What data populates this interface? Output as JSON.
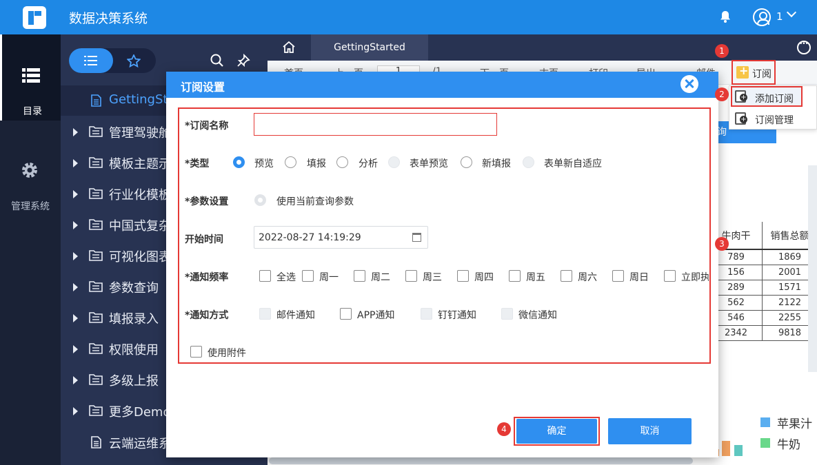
{
  "app": {
    "title": "数据决策系统",
    "user": "1"
  },
  "leftnav": {
    "directory_label": "目录",
    "admin_label": "管理系统"
  },
  "tree": {
    "items": [
      {
        "label": "GettingStarted"
      },
      {
        "label": "管理驾驶舱"
      },
      {
        "label": "模板主题示例"
      },
      {
        "label": "行业化模板"
      },
      {
        "label": "中国式复杂报表"
      },
      {
        "label": "可视化图表"
      },
      {
        "label": "参数查询"
      },
      {
        "label": "填报录入"
      },
      {
        "label": "权限使用"
      },
      {
        "label": "多级上报"
      },
      {
        "label": "更多Demo"
      },
      {
        "label": "云端运维系统"
      }
    ]
  },
  "tabs": {
    "active": "GettingStarted"
  },
  "toolbar": {
    "first": "首页",
    "prev": "上一页",
    "page_value": "1",
    "page_total": "/1",
    "next": "下一页",
    "last": "末页",
    "print": "打印",
    "export": "导出",
    "mail": "邮件",
    "subscribe": "订阅"
  },
  "subscribe_menu": {
    "add": "添加订阅",
    "manage": "订阅管理"
  },
  "report": {
    "query_button": "查询",
    "headers": [
      "牛肉干",
      "销售总额"
    ],
    "rows": [
      [
        "789",
        "1869"
      ],
      [
        "156",
        "2001"
      ],
      [
        "289",
        "1571"
      ],
      [
        "562",
        "2122"
      ],
      [
        "546",
        "2255"
      ],
      [
        "2342",
        "9818"
      ]
    ],
    "legend": [
      {
        "label": "苹果汁",
        "color": "#5aaef0"
      },
      {
        "label": "牛奶",
        "color": "#69d88a"
      }
    ]
  },
  "modal": {
    "title": "订阅设置",
    "name_label": "*订阅名称",
    "name_value": "",
    "type_label": "*类型",
    "types": [
      {
        "label": "预览",
        "state": "checked"
      },
      {
        "label": "填报",
        "state": "unchecked"
      },
      {
        "label": "分析",
        "state": "unchecked"
      },
      {
        "label": "表单预览",
        "state": "disabled"
      },
      {
        "label": "新填报",
        "state": "unchecked"
      },
      {
        "label": "表单新自适应",
        "state": "disabled"
      }
    ],
    "param_label": "*参数设置",
    "param_option": "使用当前查询参数",
    "start_label": "开始时间",
    "start_value": "2022-08-27 14:19:29",
    "freq_label": "*通知频率",
    "freq": [
      "全选",
      "周一",
      "周二",
      "周三",
      "周四",
      "周五",
      "周六",
      "周日",
      "立即执"
    ],
    "method_label": "*通知方式",
    "methods": [
      {
        "label": "邮件通知",
        "state": "disabled"
      },
      {
        "label": "APP通知",
        "state": "unchecked"
      },
      {
        "label": "钉钉通知",
        "state": "disabled"
      },
      {
        "label": "微信通知",
        "state": "disabled"
      }
    ],
    "attachment": "使用附件",
    "ok": "确定",
    "cancel": "取消"
  },
  "markers": [
    "1",
    "2",
    "3",
    "4"
  ]
}
